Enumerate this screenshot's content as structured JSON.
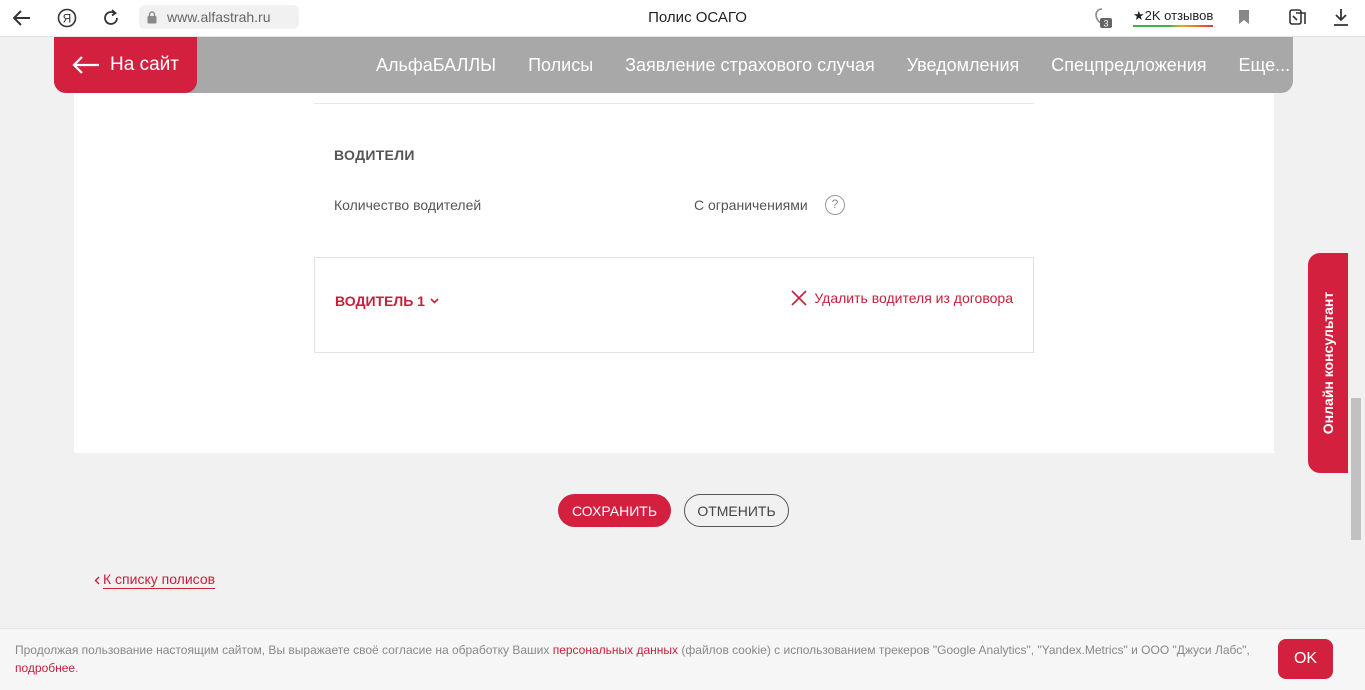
{
  "browser": {
    "url": "www.alfastrah.ru",
    "title": "Полис ОСАГО",
    "reviews": "★2K отзывов",
    "tab_count": "3"
  },
  "nav": {
    "back_label": "На сайт",
    "items": [
      "АльфаБАЛЛЫ",
      "Полисы",
      "Заявление страхового случая",
      "Уведомления",
      "Спецпредложения",
      "Еще..."
    ]
  },
  "drivers": {
    "section_title": "ВОДИТЕЛИ",
    "count_label": "Количество водителей",
    "count_value": "С ограничениями",
    "help": "?",
    "driver_title": "ВОДИТЕЛЬ 1",
    "remove_label": "Удалить водителя из договора"
  },
  "actions": {
    "save": "СОХРАНИТЬ",
    "cancel": "ОТМЕНИТЬ",
    "back_to_list": "К списку полисов"
  },
  "consultant": {
    "label": "Онлайн консультант"
  },
  "cookie": {
    "text_1": "Продолжая пользование настоящим сайтом, Вы выражаете своё согласие на обработку Ваших ",
    "link_1": "персональных данных",
    "text_2": " (файлов cookie) с использованием трекеров \"Google Analytics\",  \"Yandex.Metrics\" и ООО \"Джуси Лабс\", ",
    "link_2": "подробнее",
    "text_3": ".",
    "ok": "OK"
  },
  "colors": {
    "accent": "#d3203f",
    "nav_bg": "#a8a8a8",
    "page_bg": "#f2f1f1"
  }
}
